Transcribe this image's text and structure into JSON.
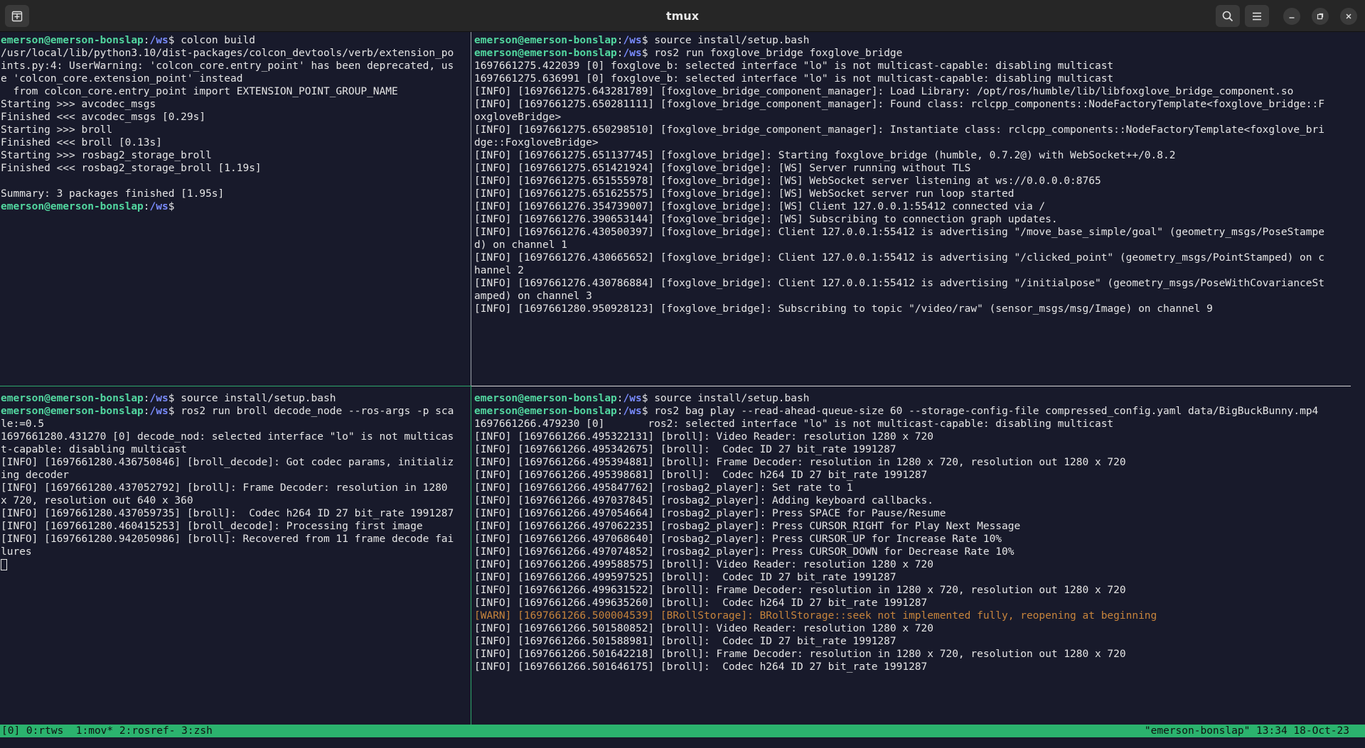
{
  "window": {
    "title": "tmux",
    "icons": {
      "new_tab": "new-tab-icon",
      "search": "search-icon",
      "menu": "hamburger-menu-icon",
      "minimize": "minimize-icon",
      "maximize": "maximize-icon",
      "close": "close-icon"
    }
  },
  "colors": {
    "background": "#181a2b",
    "prompt_user": "#52d7a0",
    "prompt_path": "#7a8cff",
    "warning": "#c7843c",
    "status_bar": "#2bb36e"
  },
  "panes": {
    "top_left": {
      "lines": [
        {
          "user": "emerson@emerson-bonslap",
          "path": "/ws",
          "cmd": " colcon build"
        },
        {
          "text": "/usr/local/lib/python3.10/dist-packages/colcon_devtools/verb/extension_po"
        },
        {
          "text": "ints.py:4: UserWarning: 'colcon_core.entry_point' has been deprecated, us"
        },
        {
          "text": "e 'colcon_core.extension_point' instead"
        },
        {
          "text": "  from colcon_core.entry_point import EXTENSION_POINT_GROUP_NAME"
        },
        {
          "text": "Starting >>> avcodec_msgs"
        },
        {
          "text": "Finished <<< avcodec_msgs [0.29s]"
        },
        {
          "text": "Starting >>> broll"
        },
        {
          "text": "Finished <<< broll [0.13s]"
        },
        {
          "text": "Starting >>> rosbag2_storage_broll"
        },
        {
          "text": "Finished <<< rosbag2_storage_broll [1.19s]"
        },
        {
          "text": ""
        },
        {
          "text": "Summary: 3 packages finished [1.95s]"
        },
        {
          "user": "emerson@emerson-bonslap",
          "path": "/ws",
          "cmd": ""
        }
      ]
    },
    "top_right": {
      "lines": [
        {
          "user": "emerson@emerson-bonslap",
          "path": "/ws",
          "cmd": " source install/setup.bash"
        },
        {
          "user": "emerson@emerson-bonslap",
          "path": "/ws",
          "cmd": " ros2 run foxglove_bridge foxglove_bridge"
        },
        {
          "text": "1697661275.422039 [0] foxglove_b: selected interface \"lo\" is not multicast-capable: disabling multicast"
        },
        {
          "text": "1697661275.636991 [0] foxglove_b: selected interface \"lo\" is not multicast-capable: disabling multicast"
        },
        {
          "text": "[INFO] [1697661275.643281789] [foxglove_bridge_component_manager]: Load Library: /opt/ros/humble/lib/libfoxglove_bridge_component.so"
        },
        {
          "text": "[INFO] [1697661275.650281111] [foxglove_bridge_component_manager]: Found class: rclcpp_components::NodeFactoryTemplate<foxglove_bridge::F"
        },
        {
          "text": "oxgloveBridge>"
        },
        {
          "text": "[INFO] [1697661275.650298510] [foxglove_bridge_component_manager]: Instantiate class: rclcpp_components::NodeFactoryTemplate<foxglove_bri"
        },
        {
          "text": "dge::FoxgloveBridge>"
        },
        {
          "text": "[INFO] [1697661275.651137745] [foxglove_bridge]: Starting foxglove_bridge (humble, 0.7.2@) with WebSocket++/0.8.2"
        },
        {
          "text": "[INFO] [1697661275.651421924] [foxglove_bridge]: [WS] Server running without TLS"
        },
        {
          "text": "[INFO] [1697661275.651555978] [foxglove_bridge]: [WS] WebSocket server listening at ws://0.0.0.0:8765"
        },
        {
          "text": "[INFO] [1697661275.651625575] [foxglove_bridge]: [WS] WebSocket server run loop started"
        },
        {
          "text": "[INFO] [1697661276.354739007] [foxglove_bridge]: [WS] Client 127.0.0.1:55412 connected via /"
        },
        {
          "text": "[INFO] [1697661276.390653144] [foxglove_bridge]: [WS] Subscribing to connection graph updates."
        },
        {
          "text": "[INFO] [1697661276.430500397] [foxglove_bridge]: Client 127.0.0.1:55412 is advertising \"/move_base_simple/goal\" (geometry_msgs/PoseStampe"
        },
        {
          "text": "d) on channel 1"
        },
        {
          "text": "[INFO] [1697661276.430665652] [foxglove_bridge]: Client 127.0.0.1:55412 is advertising \"/clicked_point\" (geometry_msgs/PointStamped) on c"
        },
        {
          "text": "hannel 2"
        },
        {
          "text": "[INFO] [1697661276.430786884] [foxglove_bridge]: Client 127.0.0.1:55412 is advertising \"/initialpose\" (geometry_msgs/PoseWithCovarianceSt"
        },
        {
          "text": "amped) on channel 3"
        },
        {
          "text": "[INFO] [1697661280.950928123] [foxglove_bridge]: Subscribing to topic \"/video/raw\" (sensor_msgs/msg/Image) on channel 9"
        }
      ]
    },
    "bottom_left": {
      "lines": [
        {
          "user": "emerson@emerson-bonslap",
          "path": "/ws",
          "cmd": " source install/setup.bash"
        },
        {
          "user": "emerson@emerson-bonslap",
          "path": "/ws",
          "cmd": " ros2 run broll decode_node --ros-args -p sca"
        },
        {
          "text": "le:=0.5"
        },
        {
          "text": "1697661280.431270 [0] decode_nod: selected interface \"lo\" is not multicas"
        },
        {
          "text": "t-capable: disabling multicast"
        },
        {
          "text": "[INFO] [1697661280.436750846] [broll_decode]: Got codec params, initializ"
        },
        {
          "text": "ing decoder"
        },
        {
          "text": "[INFO] [1697661280.437052792] [broll]: Frame Decoder: resolution in 1280"
        },
        {
          "text": "x 720, resolution out 640 x 360"
        },
        {
          "text": "[INFO] [1697661280.437059735] [broll]:  Codec h264 ID 27 bit_rate 1991287"
        },
        {
          "text": "[INFO] [1697661280.460415253] [broll_decode]: Processing first image"
        },
        {
          "text": "[INFO] [1697661280.942050986] [broll]: Recovered from 11 frame decode fai"
        },
        {
          "text": "lures"
        }
      ]
    },
    "bottom_right": {
      "lines": [
        {
          "user": "emerson@emerson-bonslap",
          "path": "/ws",
          "cmd": " source install/setup.bash"
        },
        {
          "user": "emerson@emerson-bonslap",
          "path": "/ws",
          "cmd": " ros2 bag play --read-ahead-queue-size 60 --storage-config-file compressed_config.yaml data/BigBuckBunny.mp4"
        },
        {
          "text": "1697661266.479230 [0]       ros2: selected interface \"lo\" is not multicast-capable: disabling multicast"
        },
        {
          "text": "[INFO] [1697661266.495322131] [broll]: Video Reader: resolution 1280 x 720"
        },
        {
          "text": "[INFO] [1697661266.495342675] [broll]:  Codec ID 27 bit_rate 1991287"
        },
        {
          "text": "[INFO] [1697661266.495394881] [broll]: Frame Decoder: resolution in 1280 x 720, resolution out 1280 x 720"
        },
        {
          "text": "[INFO] [1697661266.495398681] [broll]:  Codec h264 ID 27 bit_rate 1991287"
        },
        {
          "text": "[INFO] [1697661266.495847762] [rosbag2_player]: Set rate to 1"
        },
        {
          "text": "[INFO] [1697661266.497037845] [rosbag2_player]: Adding keyboard callbacks."
        },
        {
          "text": "[INFO] [1697661266.497054664] [rosbag2_player]: Press SPACE for Pause/Resume"
        },
        {
          "text": "[INFO] [1697661266.497062235] [rosbag2_player]: Press CURSOR_RIGHT for Play Next Message"
        },
        {
          "text": "[INFO] [1697661266.497068640] [rosbag2_player]: Press CURSOR_UP for Increase Rate 10%"
        },
        {
          "text": "[INFO] [1697661266.497074852] [rosbag2_player]: Press CURSOR_DOWN for Decrease Rate 10%"
        },
        {
          "text": "[INFO] [1697661266.499588575] [broll]: Video Reader: resolution 1280 x 720"
        },
        {
          "text": "[INFO] [1697661266.499597525] [broll]:  Codec ID 27 bit_rate 1991287"
        },
        {
          "text": "[INFO] [1697661266.499631522] [broll]: Frame Decoder: resolution in 1280 x 720, resolution out 1280 x 720"
        },
        {
          "text": "[INFO] [1697661266.499635260] [broll]:  Codec h264 ID 27 bit_rate 1991287"
        },
        {
          "text": "[WARN] [1697661266.500004539] [BRollStorage]: BRollStorage::seek not implemented fully, reopening at beginning",
          "level": "warn"
        },
        {
          "text": "[INFO] [1697661266.501580852] [broll]: Video Reader: resolution 1280 x 720"
        },
        {
          "text": "[INFO] [1697661266.501588981] [broll]:  Codec ID 27 bit_rate 1991287"
        },
        {
          "text": "[INFO] [1697661266.501642218] [broll]: Frame Decoder: resolution in 1280 x 720, resolution out 1280 x 720"
        },
        {
          "text": "[INFO] [1697661266.501646175] [broll]:  Codec h264 ID 27 bit_rate 1991287"
        }
      ]
    }
  },
  "status_bar": {
    "left": "[0] 0:rtws  1:mov* 2:rosref- 3:zsh",
    "right": "\"emerson-bonslap\" 13:34 18-Oct-23"
  }
}
